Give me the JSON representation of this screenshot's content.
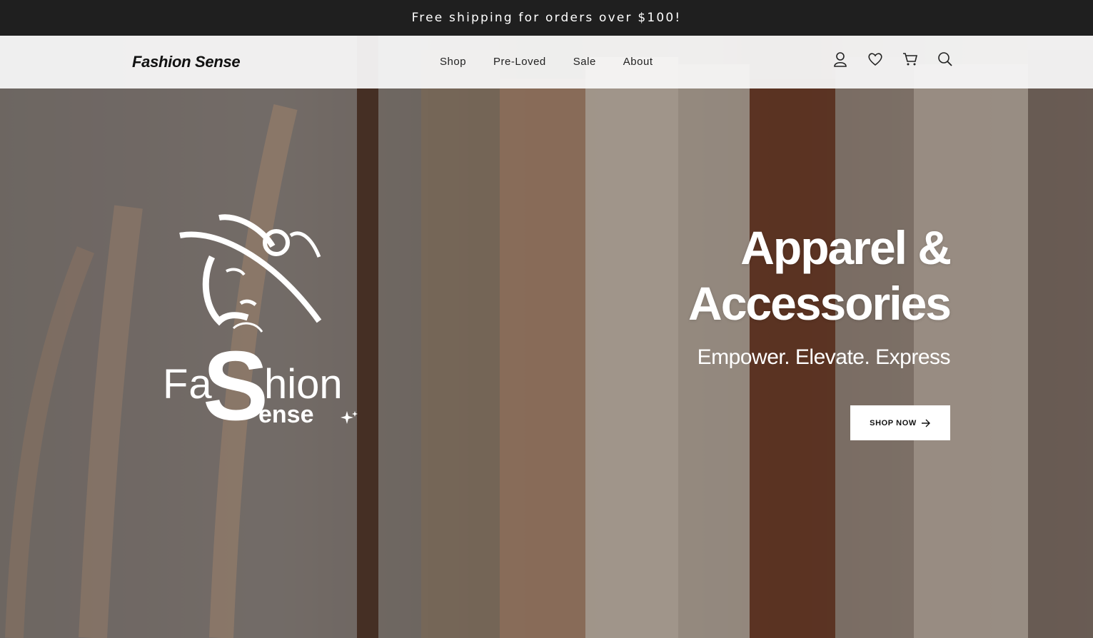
{
  "announcement": {
    "text": "Free shipping for orders over $100!"
  },
  "header": {
    "brand": "Fashion Sense",
    "nav": [
      {
        "label": "Shop"
      },
      {
        "label": "Pre-Loved"
      },
      {
        "label": "Sale"
      },
      {
        "label": "About"
      }
    ],
    "icons": [
      "user-icon",
      "heart-icon",
      "cart-icon",
      "search-icon"
    ]
  },
  "hero": {
    "logo": {
      "fa": "Fa",
      "s": "S",
      "hion": "hion",
      "ense": "ense"
    },
    "title_line1": "Apparel &",
    "title_line2": "Accessories",
    "subtitle": "Empower. Elevate. Express",
    "cta_label": "SHOP NOW",
    "cta_icon": "arrow-right-icon"
  },
  "colors": {
    "announcement_bg": "#1f1f1f",
    "header_bg": "#f8f8f8",
    "hero_text": "#ffffff"
  }
}
